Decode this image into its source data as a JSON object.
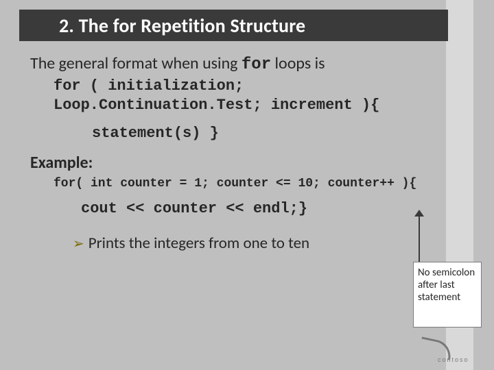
{
  "title": "2.   The for Repetition Structure",
  "general_a": "The general format when using ",
  "general_kw": "for",
  "general_b": " loops is",
  "code": {
    "l1": "for ( initialization;",
    "l2": "  Loop.Continuation.Test; increment ){",
    "l3": "statement(s)  }"
  },
  "example_label": "Example:",
  "code2": "for( int counter = 1; counter <= 10; counter++ ){",
  "code3": "cout << counter << endl;}",
  "bullet": "Prints the integers from one to ten",
  "note": "No semicolon after last statement",
  "logo_text": "contoso"
}
